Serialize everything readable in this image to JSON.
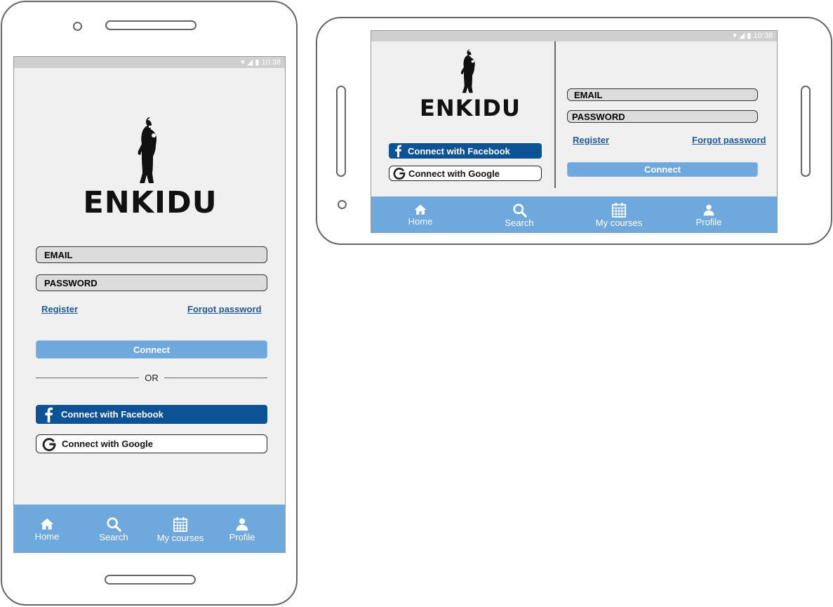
{
  "app": {
    "title": "ENKIDU",
    "status_time": "10:38"
  },
  "login": {
    "email_label": "EMAIL",
    "password_label": "PASSWORD",
    "register": "Register",
    "forgot": "Forgot password",
    "connect": "Connect",
    "or": "OR",
    "facebook": "Connect with Facebook",
    "google": "Connect with Google"
  },
  "nav": {
    "items": [
      {
        "label": "Home",
        "icon": "home-icon"
      },
      {
        "label": "Search",
        "icon": "search-icon"
      },
      {
        "label": "My courses",
        "icon": "calendar-icon"
      },
      {
        "label": "Profile",
        "icon": "user-icon"
      }
    ]
  },
  "colors": {
    "nav_bar": "#6fa8dc",
    "connect_button": "#6fa8dc",
    "facebook_button": "#0b5394",
    "link": "#1f5a96",
    "screen_bg": "#f0f0f0",
    "status_bar": "#cfcfcf"
  }
}
